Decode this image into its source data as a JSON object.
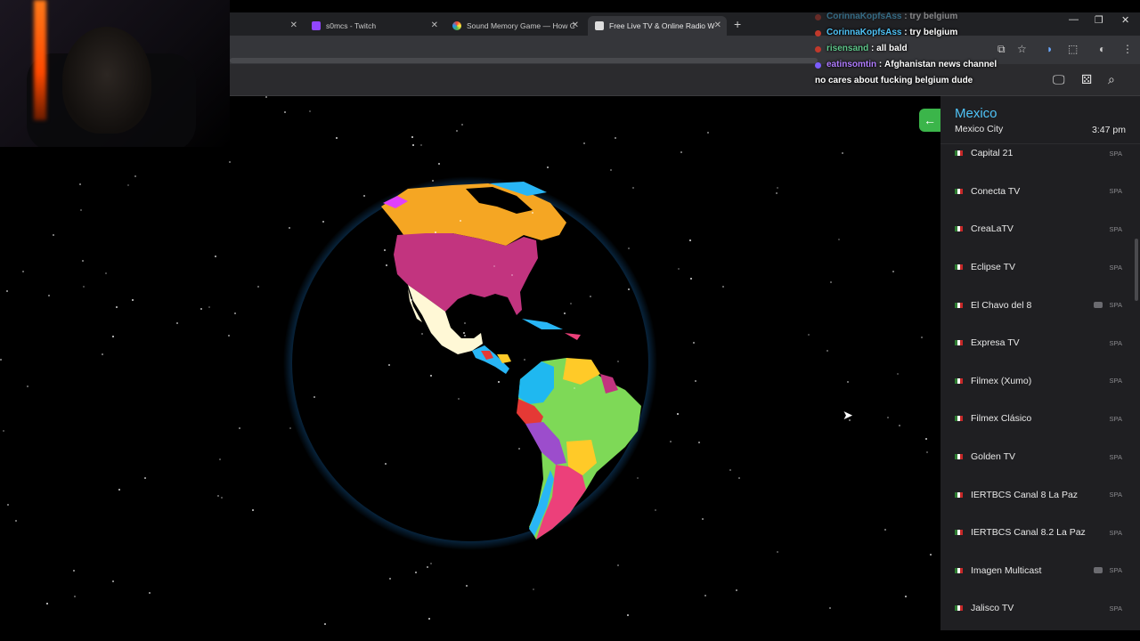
{
  "tabs": [
    {
      "title": "",
      "favicon_color": "#202124"
    },
    {
      "title": "s0mcs - Twitch",
      "favicon_color": "#9146ff"
    },
    {
      "title": "Sound Memory Game — How C",
      "favicon_color": "#f4b400"
    },
    {
      "title": "Free Live TV & Online Radio W",
      "favicon_color": "#dddddd"
    }
  ],
  "chat": [
    {
      "user": "CorinnaKopfsAss",
      "text": "try belgium",
      "user_color": "#4fc3f7"
    },
    {
      "user": "risensand",
      "text": "all bald",
      "user_color": "#5ec68a"
    },
    {
      "user": "eatinsomtin",
      "text": "Afghanistan news channel",
      "user_color": "#b07cff"
    },
    {
      "user": "",
      "text": "no cares about fucking belgium dude",
      "user_color": "#ffffff"
    }
  ],
  "panel": {
    "country": "Mexico",
    "city": "Mexico City",
    "time": "3:47 pm"
  },
  "channels": [
    {
      "name": "Capital 21",
      "lang": "SPA",
      "video": false
    },
    {
      "name": "Conecta TV",
      "lang": "SPA",
      "video": false
    },
    {
      "name": "CreaLaTV",
      "lang": "SPA",
      "video": false
    },
    {
      "name": "Eclipse TV",
      "lang": "SPA",
      "video": false
    },
    {
      "name": "El Chavo del 8",
      "lang": "SPA",
      "video": true
    },
    {
      "name": "Expresa TV",
      "lang": "SPA",
      "video": false
    },
    {
      "name": "Filmex (Xumo)",
      "lang": "SPA",
      "video": false
    },
    {
      "name": "Filmex Clásico",
      "lang": "SPA",
      "video": false
    },
    {
      "name": "Golden TV",
      "lang": "SPA",
      "video": false
    },
    {
      "name": "IERTBCS Canal 8 La Paz",
      "lang": "SPA",
      "video": false
    },
    {
      "name": "IERTBCS Canal 8.2 La Paz",
      "lang": "SPA",
      "video": false
    },
    {
      "name": "Imagen Multicast",
      "lang": "SPA",
      "video": true
    },
    {
      "name": "Jalisco TV",
      "lang": "SPA",
      "video": false
    }
  ],
  "icons": {
    "back": "arrow-left-icon",
    "tv": "monitor-icon",
    "shuffle": "dice-icon",
    "search": "search-icon"
  },
  "colors": {
    "accent_green": "#3bb54a",
    "country_blue": "#4fc3f7",
    "panel_bg": "#1f1f22"
  }
}
